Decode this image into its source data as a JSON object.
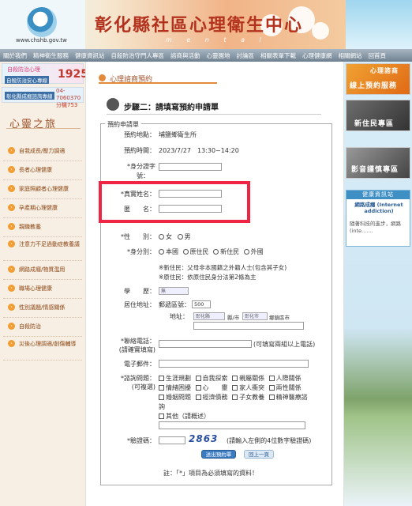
{
  "header": {
    "url": "www.chshb.gov.tw",
    "title": "彰化縣社區心理衛生中心",
    "subtitle": "m e n t a l"
  },
  "nav": [
    "關於我們",
    "精神衛生服務",
    "健康資訊站",
    "自殺防治守門人專區",
    "諮商與活動",
    "心靈園地",
    "討論區",
    "相關表單下載",
    "心理健康網",
    "相關網站",
    "回首頁"
  ],
  "left": {
    "banner1_title": "自殺防治心理",
    "banner1_number": "1925",
    "banner1_label": "自殺防治安心專線",
    "banner2_label": "彰化縣成癮諮詢專線",
    "banner2_number": "04-7060370",
    "banner2_ext": "分機753",
    "section_title": "心靈之旅",
    "items": [
      "自我成長/壓力調適",
      "長者心理健康",
      "家庭照顧者心理健康",
      "孕產期心理健康",
      "親職教養",
      "注意力不足過動症教養議",
      "網路成癮/物質濫用",
      "職場心理健康",
      "性別議題/情感關係",
      "自殺防治",
      "災後心理調適/創傷輔導"
    ]
  },
  "main": {
    "tab_title": "心理諮商預約",
    "step_title": "步驟二：請填寫預約申請單",
    "legend": "預約申請單",
    "location_label": "預約地點：",
    "location_value": "埔鹽鄉衛生所",
    "time_label": "預約時間：",
    "time_value": "2023/7/27　13:30~14:20",
    "id_label": "*身分證字",
    "id_label2": "號：",
    "name_label": "*真實姓名：",
    "alias_label": "匿　　名：",
    "gender_label": "*性　　別：",
    "gender_opts": [
      "女",
      "男"
    ],
    "identity_label": "*身分別：",
    "identity_opts": [
      "本國",
      "原住民",
      "新住民",
      "外國"
    ],
    "note1": "※新住民：父母非本國籍之外籍人士(包含其子女)",
    "note2": "※原住民：依原住民身分法第2條為主",
    "edu_label": "學　　歷：",
    "edu_value": "無",
    "addr_label": "居住地址：",
    "zip_label": "郵遞區號：",
    "zip_value": "500",
    "address_label": "地址：",
    "county_value": "彰化縣",
    "county_unit": "縣/市",
    "city_value": "彰化市",
    "city_unit": "鄉鎮區市",
    "phone_label": "*聯絡電話：",
    "phone_label2": "(請確實填寫)",
    "phone_hint": "(可填寫兩組以上電話)",
    "email_label": "電子郵件：",
    "issue_label": "*諮詢問題：",
    "issue_label2": "(可複選)",
    "issue_row1": [
      "生涯規劃",
      "自我探索",
      "親屬關係",
      "人際關係"
    ],
    "issue_row2": [
      "情緒困擾",
      "心　　靈",
      "家人衝突",
      "兩性關係"
    ],
    "issue_row3": [
      "婚姻問題",
      "經濟債務",
      "子女教養",
      "精神醫療諮"
    ],
    "issue_row3_tail": "詢",
    "issue_other": "其他（請概述）",
    "captcha_label": "*驗證碼：",
    "captcha_value": "2863",
    "captcha_hint": "(請輸入左側的4位數字驗證碼)",
    "submit_label": "送出預約單",
    "back_label": "回上一頁",
    "footnote": "註：「*」項目為必須填寫的資料！"
  },
  "right": {
    "rb1_line1": "心理諮商",
    "rb1_line2": "線上預約服務",
    "rb2": "新住民專區",
    "rb3": "影音謹慎專區",
    "health_title": "健康資訊站",
    "health_sub": "網路成癮 (Internet addiction)",
    "health_body": "隨著科技的進步，網路(inte......."
  }
}
